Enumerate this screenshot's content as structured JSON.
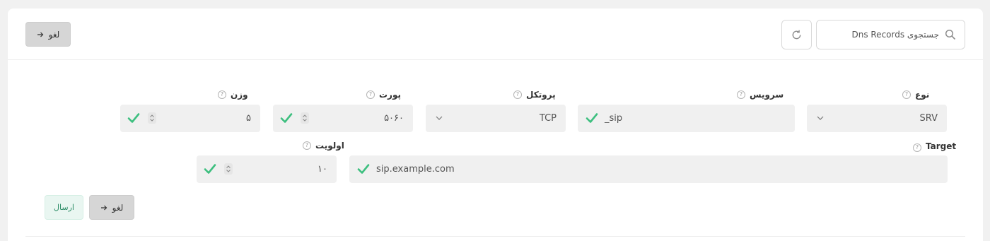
{
  "toolbar": {
    "cancel_label": "لغو",
    "search_placeholder": "جستجوی Dns Records"
  },
  "form": {
    "type": {
      "label": "نوع",
      "value": "SRV"
    },
    "service": {
      "label": "سرویس",
      "value": "_sip"
    },
    "protocol": {
      "label": "پروتکل",
      "value": "TCP"
    },
    "port": {
      "label": "پورت",
      "value": "۵۰۶۰"
    },
    "weight": {
      "label": "وزن",
      "value": "۵"
    },
    "target": {
      "label": "Target",
      "value": "sip.example.com"
    },
    "priority": {
      "label": "اولویت",
      "value": "۱۰"
    },
    "help_glyph": "?",
    "submit_label": "ارسال",
    "cancel_label": "لغو"
  },
  "colors": {
    "valid_check": "#3dbf7f",
    "submit_text": "#2a8b65"
  },
  "icons": [
    "search-icon",
    "refresh-icon",
    "arrow-right-icon",
    "check-icon",
    "chevron-down-icon",
    "stepper-icon",
    "help-icon"
  ]
}
